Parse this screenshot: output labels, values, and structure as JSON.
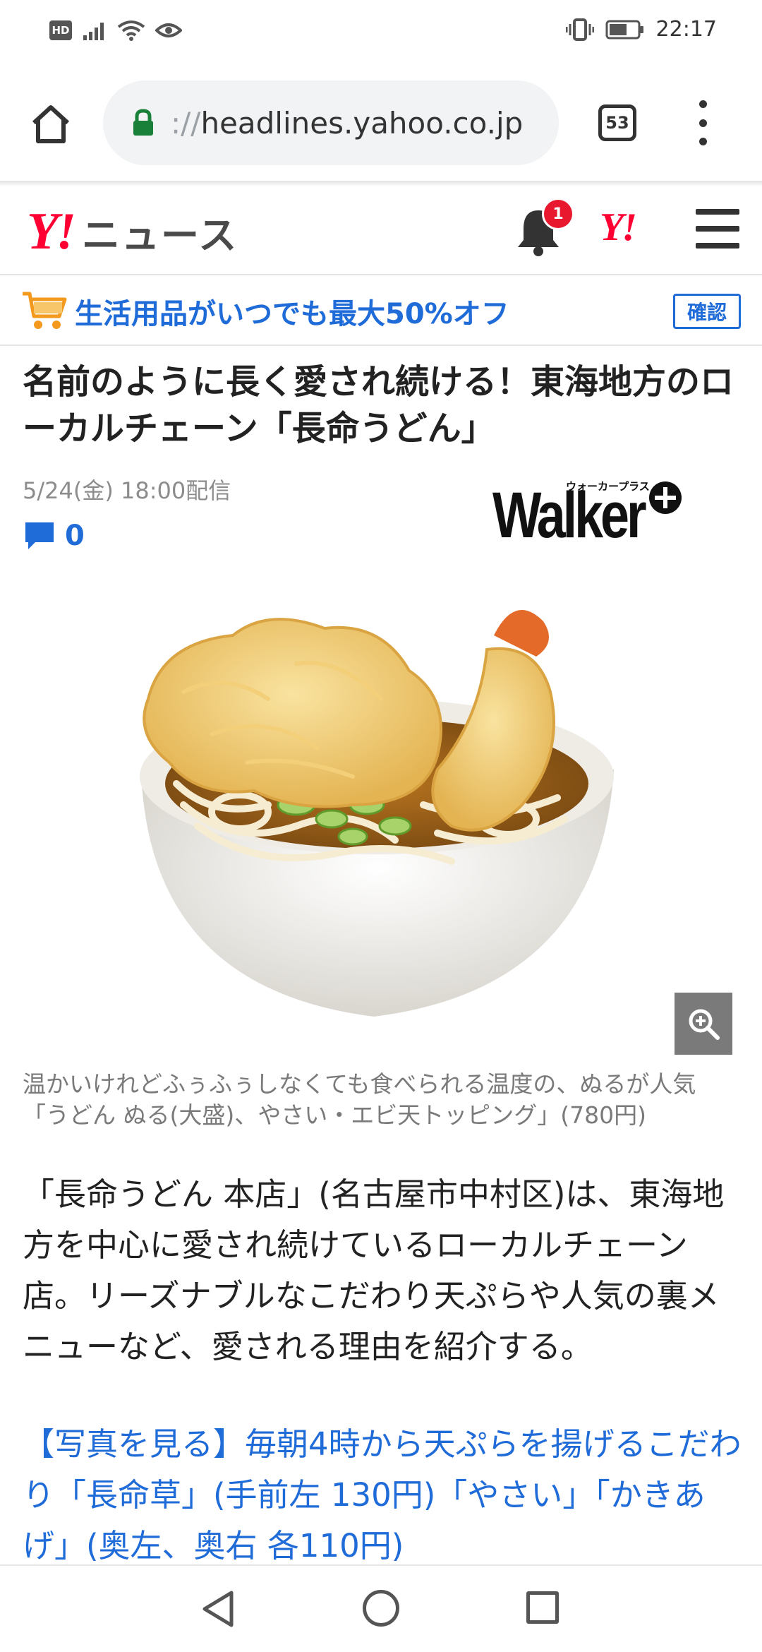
{
  "status_bar": {
    "hd_label": "HD",
    "time": "22:17"
  },
  "browser": {
    "url_prefix": "://",
    "url_host": "headlines.yahoo.co.jp",
    "tab_count": "53"
  },
  "header": {
    "logo_mark": "Y!",
    "logo_text": "ニュース",
    "notification_count": "1",
    "yahoo_mark": "Y!"
  },
  "promo": {
    "text": "生活用品がいつでも最大50%オフ",
    "button_label": "確認"
  },
  "article": {
    "headline": "名前のように長く愛され続ける！東海地方のローカルチェーン「長命うどん」",
    "published": "5/24(金) 18:00配信",
    "comment_count": "0",
    "publisher": {
      "wordmark": "Walker",
      "small_text": "ウォーカープラス"
    },
    "photo_caption": "温かいけれどふぅふぅしなくても食べられる温度の、ぬるが人気「うどん ぬる(大盛)、やさい・エビ天トッピング」(780円)",
    "body": "「長命うどん 本店」(名古屋市中村区)は、東海地方を中心に愛され続けているローカルチェーン店。リーズナブルなこだわり天ぷらや人気の裏メニューなど、愛される理由を紹介する。",
    "link": "【写真を見る】毎朝4時から天ぷらを揚げるこだわり「長命草」(手前左 130円)「やさい」「かきあげ」(奥左、奥右 各110円)"
  },
  "colors": {
    "yahoo_red": "#ff0033",
    "link_blue": "#1f6bd8",
    "badge_red": "#e8182f",
    "lock_green": "#188038"
  },
  "icons": [
    "hd-icon",
    "signal-icon",
    "wifi-icon",
    "eye-icon",
    "vibrate-icon",
    "battery-icon",
    "home-icon",
    "lock-icon",
    "more-icon",
    "bell-icon",
    "menu-icon",
    "cart-icon",
    "comment-icon",
    "zoom-icon",
    "back-icon",
    "home-circle-icon",
    "recent-apps-icon"
  ]
}
